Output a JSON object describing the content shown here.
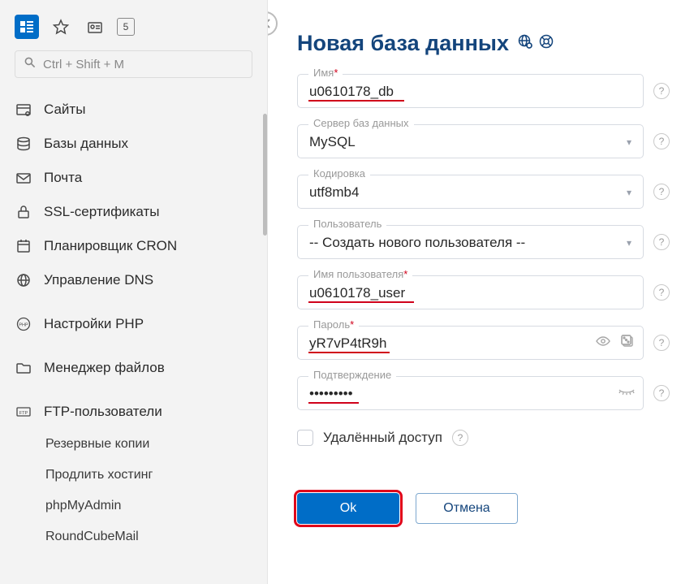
{
  "top": {
    "count_badge": "5",
    "search_placeholder": "Ctrl + Shift + M"
  },
  "nav": {
    "items": [
      {
        "label": "Сайты"
      },
      {
        "label": "Базы данных"
      },
      {
        "label": "Почта"
      },
      {
        "label": "SSL-сертификаты"
      },
      {
        "label": "Планировщик CRON"
      },
      {
        "label": "Управление DNS"
      }
    ],
    "php_label": "Настройки PHP",
    "fm_label": "Менеджер файлов",
    "ftp_label": "FTP-пользователи",
    "sub": [
      {
        "label": "Резервные копии"
      },
      {
        "label": "Продлить хостинг"
      },
      {
        "label": "phpMyAdmin"
      },
      {
        "label": "RoundCubeMail"
      }
    ]
  },
  "page": {
    "title": "Новая база данных"
  },
  "fields": {
    "name_label": "Имя",
    "name_value": "u0610178_db",
    "server_label": "Сервер баз данных",
    "server_value": "MySQL",
    "encoding_label": "Кодировка",
    "encoding_value": "utf8mb4",
    "user_label": "Пользователь",
    "user_value": "-- Создать нового пользователя --",
    "username_label": "Имя пользователя",
    "username_value": "u0610178_user",
    "password_label": "Пароль",
    "password_value": "yR7vP4tR9h",
    "confirm_label": "Подтверждение",
    "confirm_value": "•••••••••",
    "remote_label": "Удалённый доступ"
  },
  "footer": {
    "ok": "Ok",
    "cancel": "Отмена"
  },
  "help_char": "?"
}
